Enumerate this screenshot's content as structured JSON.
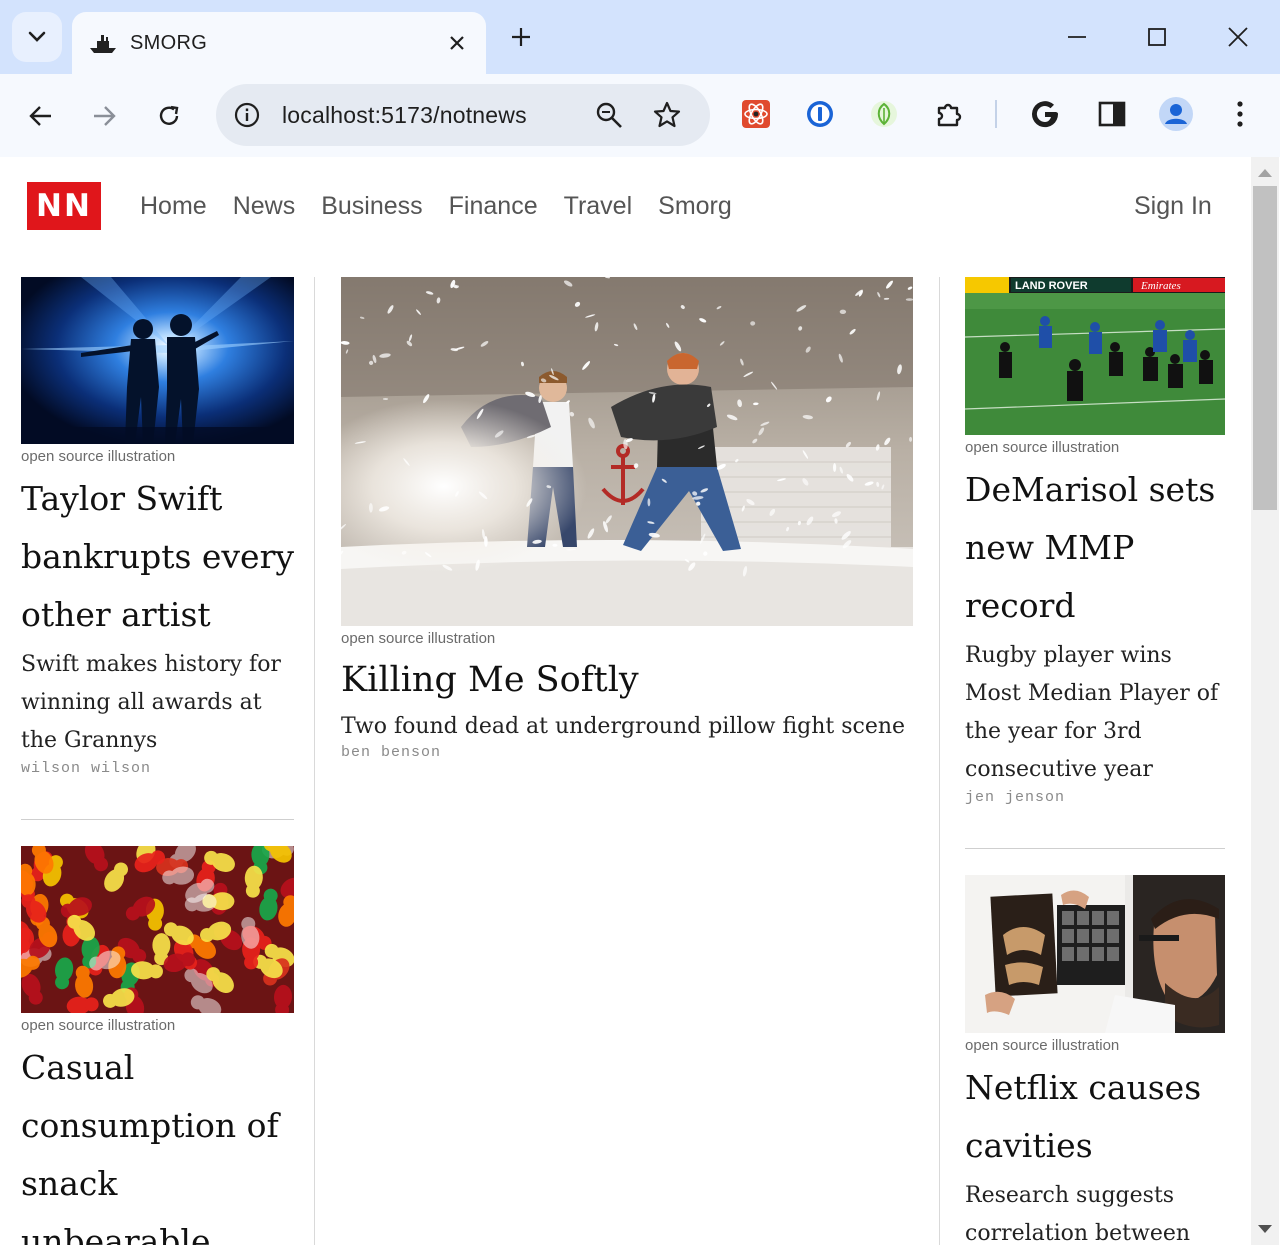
{
  "browser": {
    "tab_title": "SMORG",
    "url": "localhost:5173/notnews"
  },
  "site": {
    "logo": "NN",
    "nav": [
      "Home",
      "News",
      "Business",
      "Finance",
      "Travel",
      "Smorg"
    ],
    "sign_in": "Sign In"
  },
  "articles": {
    "left": [
      {
        "caption": "open source illustration",
        "headline": "Taylor Swift bankrupts every other artist",
        "dek": "Swift makes history for winning all awards at the Grannys",
        "byline": "wilson wilson",
        "image": "concert-silhouette"
      },
      {
        "caption": "open source illustration",
        "headline": "Casual consumption of snack unbearable",
        "image": "gummy-bears"
      }
    ],
    "main": {
      "caption": "open source illustration",
      "headline": "Killing Me Softly",
      "dek": "Two found dead at underground pillow fight scene",
      "byline": "ben benson",
      "image": "pillow-fight"
    },
    "right": [
      {
        "caption": "open source illustration",
        "headline": "DeMarisol sets new MMP record",
        "dek": "Rugby player wins Most Median Player of the year for 3rd consecutive year",
        "byline": "jen jenson",
        "image": "rugby-match",
        "image_text": [
          "LAND ROVER",
          "Emirates"
        ]
      },
      {
        "caption": "open source illustration",
        "headline": "Netflix causes cavities",
        "dek": "Research suggests correlation between",
        "image": "dentist-xray"
      }
    ]
  },
  "colors": {
    "brand_red": "#e0161b",
    "chrome_bg": "#d3e3fd"
  }
}
